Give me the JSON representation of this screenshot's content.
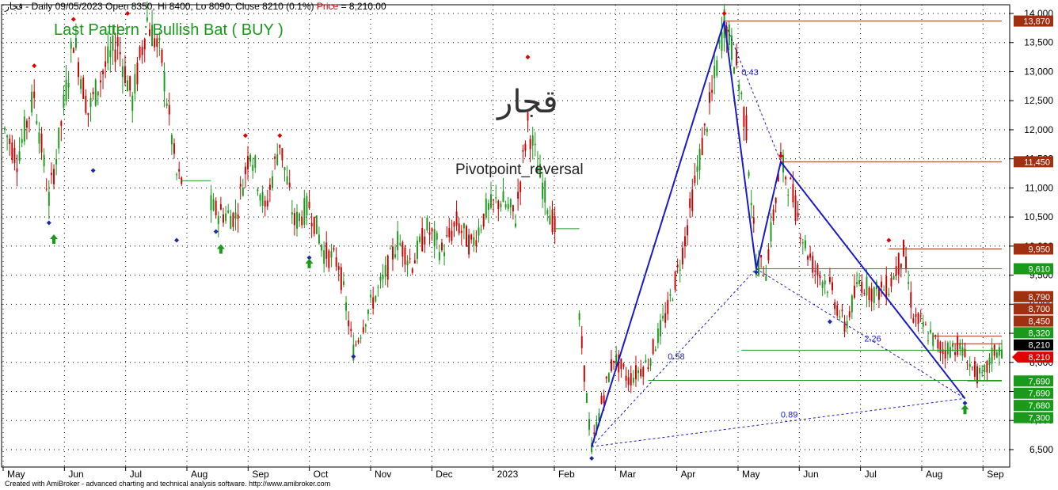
{
  "header": {
    "symbol": "قجار",
    "info": "- Daily 09/05/2023 Open 8350, Hi 8400, Lo 8090, Close 8210 (0.1%)",
    "price_label": "Price",
    "price_value": "= 8,210.00"
  },
  "pattern_label": "Last Pattern : Bullish Bat ( BUY )",
  "watermark_symbol": "قجار",
  "indicator_label": "Pivotpoint_reversal",
  "footer": "Created with AmiBroker - advanced charting and technical analysis software. http://www.amibroker.com",
  "colors": {
    "up": "#1a9a1a",
    "down": "#cc0000",
    "pattern": "#1a1ac8",
    "level_red": "#a03010",
    "level_green": "#1a9a1a",
    "current": "#e00000"
  },
  "chart_data": {
    "type": "candlestick",
    "ylim": [
      6200,
      14150
    ],
    "y_ticks": [
      6500,
      7000,
      7500,
      8000,
      8500,
      9000,
      9500,
      10000,
      10500,
      11000,
      11500,
      12000,
      12500,
      13000,
      13500,
      14000
    ],
    "y_tick_labels": [
      "6,500",
      "7,000",
      "7,500",
      "8,000",
      "8,500",
      "9,000",
      "9,500",
      "10,000",
      "10,500",
      "11,000",
      "11,500",
      "12,000",
      "12,500",
      "13,000",
      "13,500",
      "14,000"
    ],
    "x_months": [
      "May",
      "Jun",
      "Jul",
      "Aug",
      "Sep",
      "Oct",
      "Nov",
      "Dec",
      "2023",
      "Feb",
      "Mar",
      "Apr",
      "May",
      "Jun",
      "Jul",
      "Aug",
      "Sep"
    ],
    "price_path": [
      [
        0,
        12000
      ],
      [
        5,
        11500
      ],
      [
        12,
        12600
      ],
      [
        18,
        10800
      ],
      [
        22,
        11800
      ],
      [
        28,
        13600
      ],
      [
        34,
        12300
      ],
      [
        40,
        13000
      ],
      [
        46,
        13500
      ],
      [
        52,
        12500
      ],
      [
        58,
        13900
      ],
      [
        64,
        13200
      ],
      [
        70,
        11200
      ],
      [
        78,
        10900
      ],
      [
        86,
        10600
      ],
      [
        94,
        10500
      ],
      [
        100,
        11700
      ],
      [
        106,
        10600
      ],
      [
        112,
        11800
      ],
      [
        118,
        10400
      ],
      [
        124,
        10700
      ],
      [
        130,
        9900
      ],
      [
        136,
        9700
      ],
      [
        142,
        8200
      ],
      [
        148,
        8900
      ],
      [
        154,
        9400
      ],
      [
        160,
        10100
      ],
      [
        166,
        9700
      ],
      [
        172,
        10300
      ],
      [
        178,
        9900
      ],
      [
        184,
        10400
      ],
      [
        190,
        10000
      ],
      [
        196,
        10600
      ],
      [
        202,
        10800
      ],
      [
        208,
        10500
      ],
      [
        213,
        12100
      ],
      [
        218,
        11200
      ],
      [
        224,
        10300
      ],
      [
        228,
        9500
      ],
      [
        232,
        9600
      ],
      [
        239,
        6500
      ],
      [
        243,
        7300
      ],
      [
        248,
        8100
      ],
      [
        254,
        7700
      ],
      [
        262,
        8000
      ],
      [
        270,
        8900
      ],
      [
        276,
        9900
      ],
      [
        282,
        11300
      ],
      [
        288,
        12600
      ],
      [
        293,
        13870
      ],
      [
        298,
        13100
      ],
      [
        302,
        12000
      ],
      [
        306,
        9700
      ],
      [
        310,
        9600
      ],
      [
        316,
        11450
      ],
      [
        320,
        11000
      ],
      [
        326,
        10000
      ],
      [
        330,
        9600
      ],
      [
        336,
        9300
      ],
      [
        342,
        8600
      ],
      [
        348,
        9400
      ],
      [
        354,
        9200
      ],
      [
        360,
        9300
      ],
      [
        366,
        9900
      ],
      [
        370,
        8800
      ],
      [
        376,
        8500
      ],
      [
        382,
        8200
      ],
      [
        388,
        8300
      ],
      [
        394,
        7900
      ],
      [
        398,
        7700
      ],
      [
        403,
        8200
      ],
      [
        406,
        8210
      ]
    ],
    "candle_count": 407,
    "swing_highs": [
      [
        12,
        13100
      ],
      [
        28,
        13900
      ],
      [
        50,
        14000
      ],
      [
        98,
        11900
      ],
      [
        112,
        11900
      ],
      [
        213,
        13250
      ],
      [
        293,
        14000
      ],
      [
        316,
        11550
      ],
      [
        360,
        10100
      ]
    ],
    "swing_lows": [
      [
        18,
        10400
      ],
      [
        36,
        11300
      ],
      [
        70,
        10100
      ],
      [
        86,
        10250
      ],
      [
        124,
        9800
      ],
      [
        142,
        8100
      ],
      [
        239,
        6350
      ],
      [
        306,
        9550
      ],
      [
        336,
        8700
      ],
      [
        391,
        7300
      ]
    ],
    "up_arrows": [
      [
        20,
        10120
      ],
      [
        88,
        9950
      ],
      [
        124,
        9700
      ],
      [
        391,
        7190
      ]
    ],
    "pattern_legs": [
      [
        239,
        6550
      ],
      [
        293,
        13870
      ],
      [
        306,
        9610
      ],
      [
        316,
        11450
      ],
      [
        391,
        7380
      ]
    ],
    "pattern_dashes": [
      {
        "from": [
          239,
          6550
        ],
        "to": [
          306,
          9610
        ]
      },
      {
        "from": [
          293,
          13870
        ],
        "to": [
          316,
          11450
        ]
      },
      {
        "from": [
          306,
          9610
        ],
        "to": [
          391,
          7380
        ]
      },
      {
        "from": [
          239,
          6550
        ],
        "to": [
          391,
          7380
        ]
      }
    ],
    "fib_ratios": [
      {
        "label": "0.43",
        "x": 300,
        "y": 12940
      },
      {
        "label": "0.58",
        "x": 270,
        "y": 8050
      },
      {
        "label": "2.26",
        "x": 350,
        "y": 8360
      },
      {
        "label": "0.89",
        "x": 316,
        "y": 7050
      }
    ],
    "level_lines": [
      {
        "price": 13870,
        "from": 293,
        "to": 406,
        "color": "red"
      },
      {
        "price": 11450,
        "from": 316,
        "to": 406,
        "color": "red"
      },
      {
        "price": 9950,
        "from": 360,
        "to": 406,
        "color": "red"
      },
      {
        "price": 9610,
        "from": 306,
        "to": 406,
        "color": "green"
      },
      {
        "price": 7690,
        "from": 262,
        "to": 406,
        "color": "green"
      },
      {
        "price": 7680,
        "from": 392,
        "to": 406,
        "color": "green"
      },
      {
        "price": 8450,
        "from": 378,
        "to": 406,
        "color": "red"
      },
      {
        "price": 8320,
        "from": 386,
        "to": 406,
        "color": "red"
      },
      {
        "price": 8210,
        "from": 300,
        "to": 406,
        "color": "green"
      }
    ],
    "price_labels": [
      {
        "text": "13,870",
        "price": 13870,
        "color": "red"
      },
      {
        "text": "11,450",
        "price": 11450,
        "color": "red"
      },
      {
        "text": "9,950",
        "price": 9950,
        "color": "red"
      },
      {
        "text": "9,610",
        "price": 9610,
        "color": "green"
      },
      {
        "text": "8,790",
        "price": 9130,
        "color": "red"
      },
      {
        "text": "8,700",
        "price": 8920,
        "color": "red"
      },
      {
        "text": "8,450",
        "price": 8710,
        "color": "red"
      },
      {
        "text": "8,320",
        "price": 8510,
        "color": "green"
      },
      {
        "text": "8,210",
        "price": 8300,
        "color": "black"
      },
      {
        "text": "8,210",
        "price": 8090,
        "color": "current"
      },
      {
        "text": "7,690",
        "price": 7680,
        "color": "green"
      },
      {
        "text": "7,690",
        "price": 7470,
        "color": "green"
      },
      {
        "text": "7,680",
        "price": 7260,
        "color": "green"
      },
      {
        "text": "7,300",
        "price": 7050,
        "color": "green"
      }
    ]
  }
}
